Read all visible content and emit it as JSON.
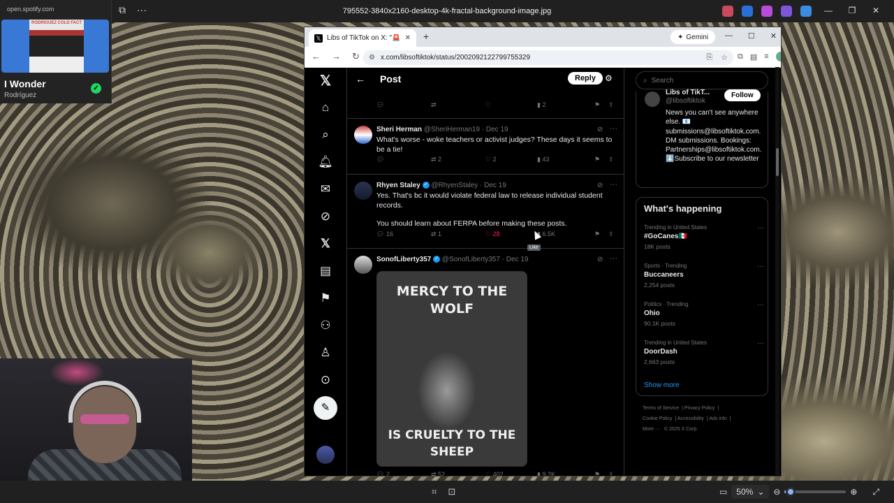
{
  "viewer": {
    "file_title": "795552-3840x2160-desktop-4k-fractal-background-image.jpg",
    "zoom": "50%",
    "zoom_level": 0.1
  },
  "spotify": {
    "url": "open.spotify.com",
    "cover_text": "RODRIGUEZ COLD FACT",
    "song": "I Wonder",
    "artist": "Rodríguez"
  },
  "browser": {
    "tab_title": "Libs of TikTok on X: \"🚨 INSANE",
    "gemini_label": "Gemini",
    "url": "x.com/libsoftiktok/status/2002092122799755329"
  },
  "x": {
    "header_title": "Post",
    "reply_label": "Reply",
    "search_placeholder": "Search",
    "top_partial_actions": {
      "views": "2"
    },
    "tweets": [
      {
        "name": "Sheri Herman",
        "handle": "@SheriHerman19",
        "date": "Dec 19",
        "text": "What's worse  - woke teachers or activist judges? These days it seems to be a tie!",
        "retweets": "2",
        "likes": "2",
        "views": "43"
      },
      {
        "name": "Rhyen Staley",
        "handle": "@RhyenStaley",
        "date": "Dec 19",
        "text": "Yes. That's bc it would violate federal law to release individual student records.",
        "text2": "You should learn about FERPA before making these posts.",
        "replies": "16",
        "retweets": "1",
        "likes": "28",
        "views": "6.5K",
        "tooltip": "Like"
      },
      {
        "name": "SonofLiberty357",
        "handle": "@SonofLiberty357",
        "date": "Dec 19",
        "media_top": "MERCY TO THE WOLF",
        "media_bottom": "IS CRUELTY TO THE SHEEP",
        "replies": "2",
        "retweets": "52",
        "likes": "402",
        "views": "9.2K"
      }
    ],
    "profile": {
      "name": "Libs of TikT...",
      "handle": "@libsoftiktok",
      "follow_label": "Follow",
      "bio": "News you can't see anywhere else. 📧 submissions@libsoftiktok.com. DM submissions. Bookings: Partnerships@libsoftiktok.com. ⬇️Subscribe to our newsletter"
    },
    "whats_happening": {
      "title": "What's happening",
      "trends": [
        {
          "context": "Trending in United States",
          "name": "#GoCanes🇲🇽",
          "count": "18K posts"
        },
        {
          "context": "Sports · Trending",
          "name": "Buccaneers",
          "count": "2,254 posts"
        },
        {
          "context": "Politics · Trending",
          "name": "Ohio",
          "count": "90.1K posts"
        },
        {
          "context": "Trending in United States",
          "name": "DoorDash",
          "count": "2,663 posts"
        }
      ],
      "show_more": "Show more"
    },
    "footer": {
      "terms": "Terms of Service",
      "privacy": "Privacy Policy",
      "cookie": "Cookie Policy",
      "accessibility": "Accessibility",
      "ads": "Ads info",
      "more": "More ···",
      "copyright": "© 2025 X Corp."
    }
  },
  "colors": {
    "x_blue": "#1d9bf0",
    "like_pink": "#f91880",
    "spotify_green": "#1ed760"
  }
}
